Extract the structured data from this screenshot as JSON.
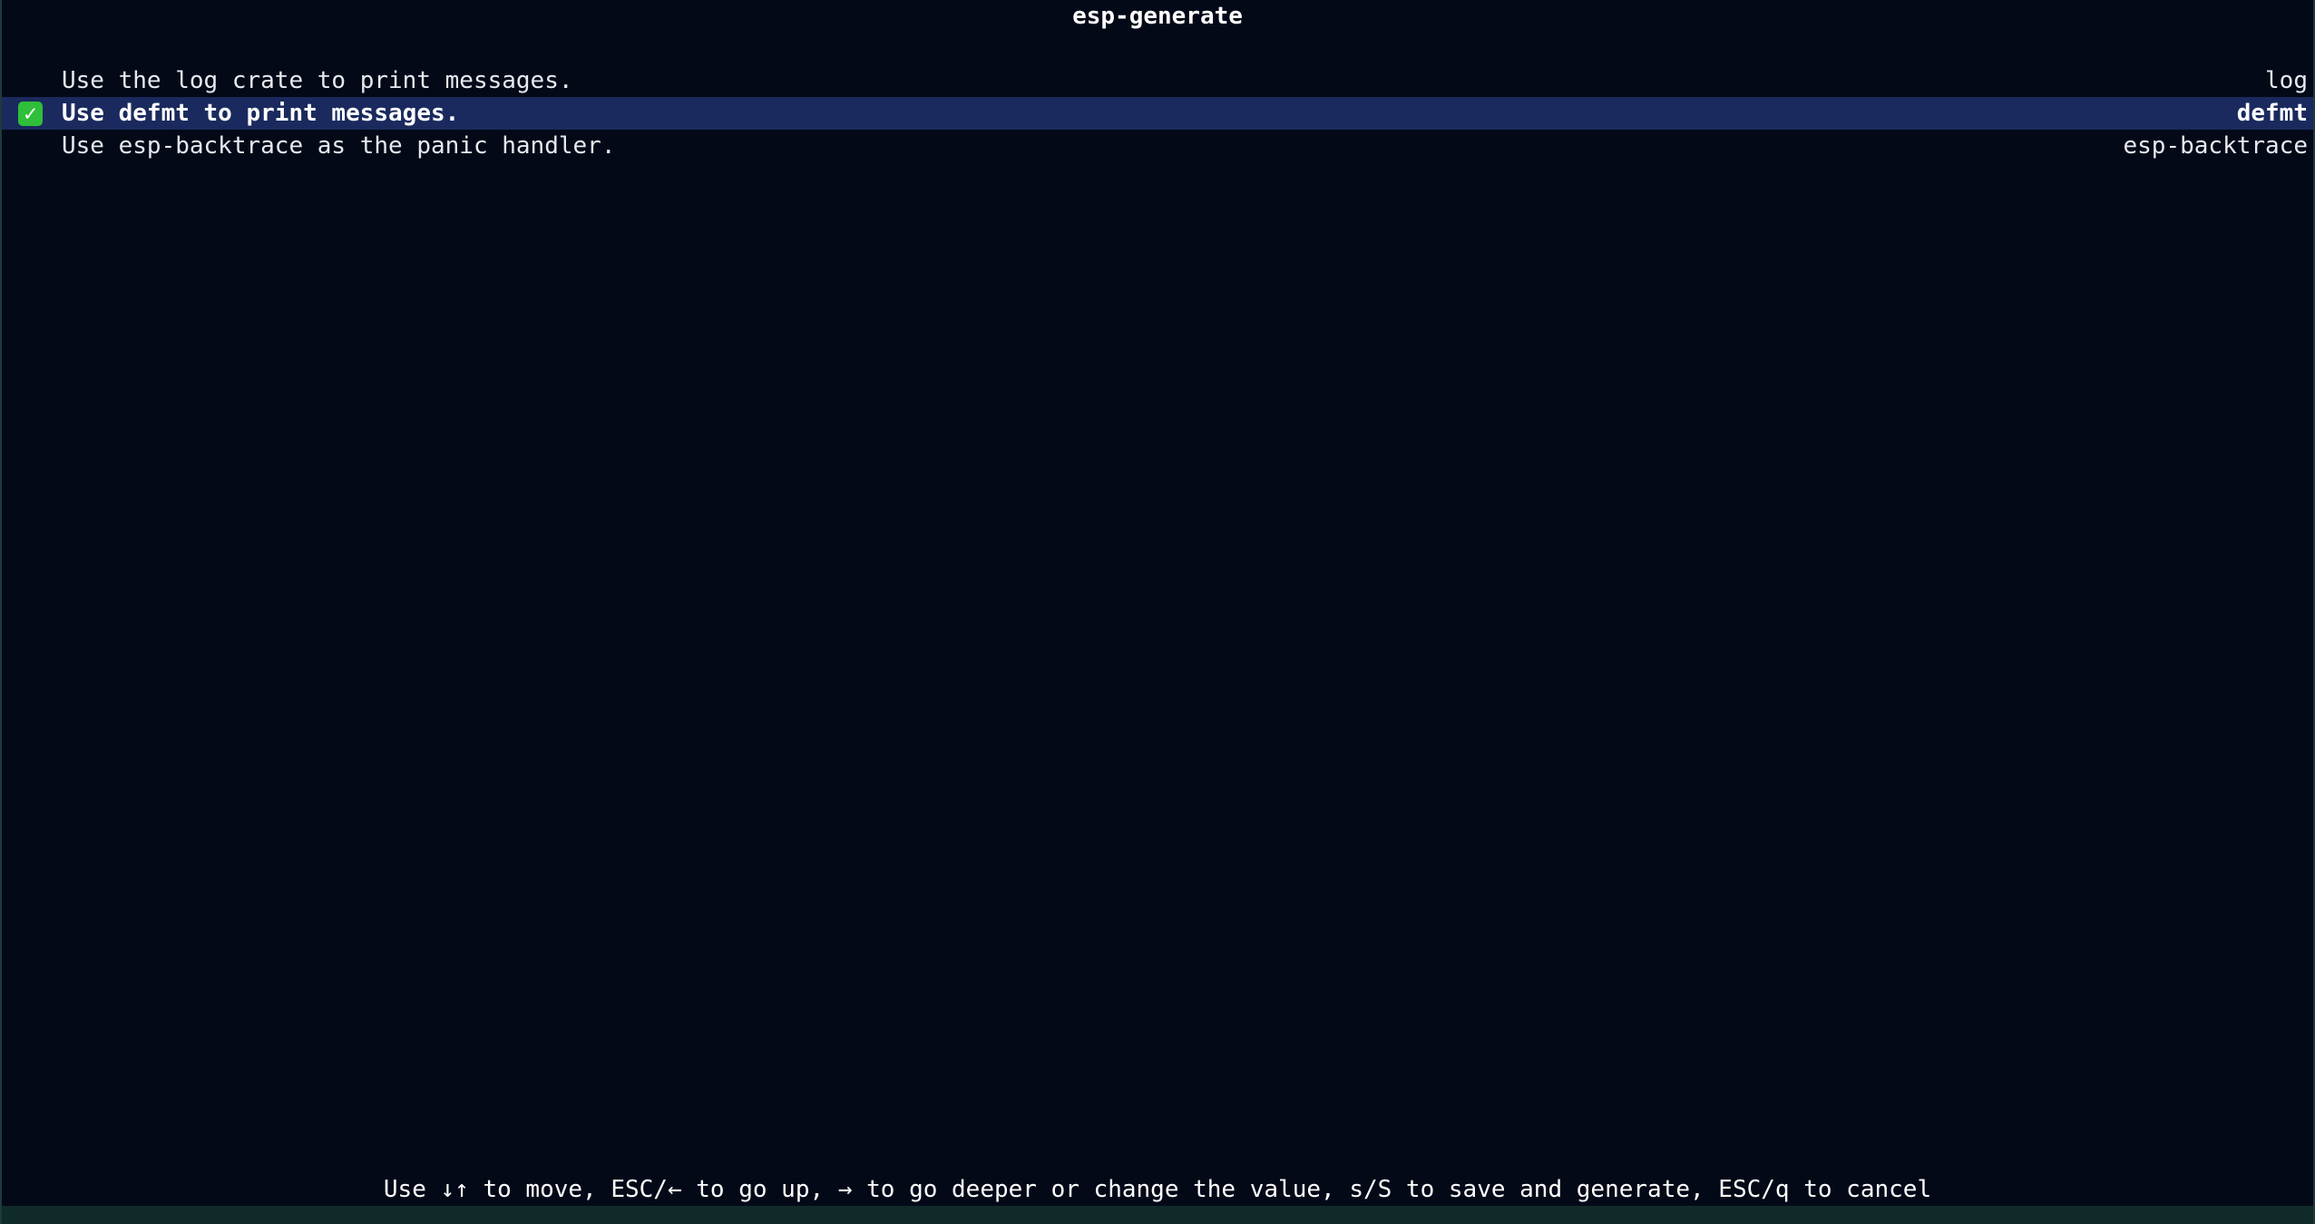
{
  "app": {
    "title": "esp-generate"
  },
  "options": [
    {
      "label": "Use the log crate to print messages.",
      "value": "log",
      "selected": false
    },
    {
      "label": "Use defmt to print messages.",
      "value": "defmt",
      "selected": true,
      "icon": "check-mark-icon"
    },
    {
      "label": "Use esp-backtrace as the panic handler.",
      "value": "esp-backtrace",
      "selected": false
    }
  ],
  "footer": {
    "help": "Use ↓↑ to move, ESC/← to go up, → to go deeper or change the value, s/S to save and generate, ESC/q to cancel"
  },
  "colors": {
    "background": "#040918",
    "selected_row": "#1a2a5e",
    "check": "#2fbf3a"
  }
}
